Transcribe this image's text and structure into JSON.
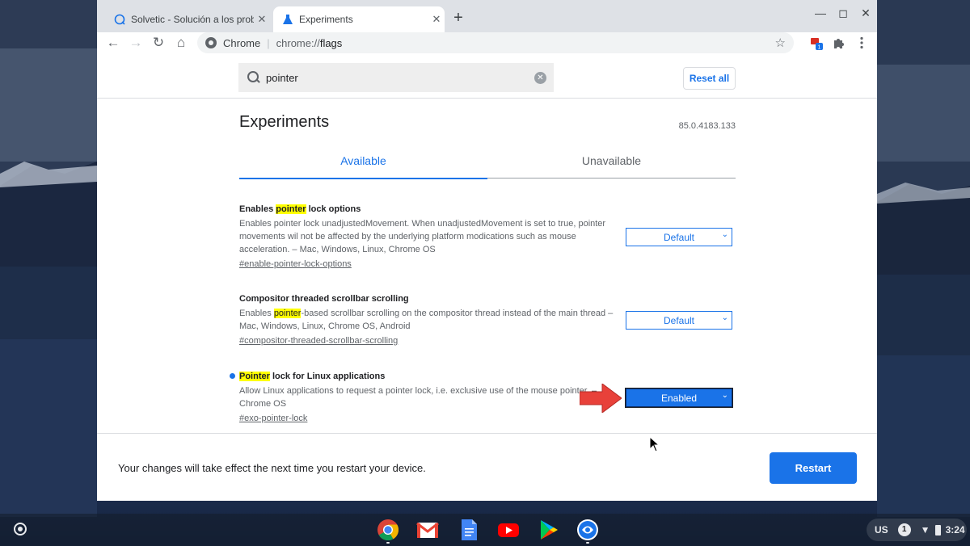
{
  "browser": {
    "tabs": [
      {
        "title": "Solvetic - Solución a los problem",
        "close": "✕"
      },
      {
        "title": "Experiments",
        "close": "✕"
      }
    ],
    "new_tab": "+",
    "window_controls": {
      "minimize": "—",
      "maximize": "◻",
      "close": "✕"
    }
  },
  "toolbar": {
    "back": "←",
    "forward": "→",
    "reload": "↻",
    "home": "⌂",
    "omnibox": {
      "site_label": "Chrome",
      "separator": "|",
      "scheme": "chrome://",
      "host": "flags"
    },
    "star": "☆",
    "extension_badge": "1"
  },
  "flags": {
    "search": {
      "value": "pointer"
    },
    "reset_all": "Reset all",
    "title": "Experiments",
    "version": "85.0.4183.133",
    "tabs": {
      "available": "Available",
      "unavailable": "Unavailable"
    },
    "experiments": [
      {
        "name_pre": "Enables ",
        "name_hl": "pointer",
        "name_post": " lock options",
        "desc_pre": "",
        "desc_hl": "",
        "desc_post": "Enables pointer lock unadjustedMovement. When unadjustedMovement is set to true, pointer movements wil not be affected by the underlying platform modications such as mouse acceleration. – Mac, Windows, Linux, Chrome OS",
        "link": "#enable-pointer-lock-options",
        "select": "Default"
      },
      {
        "name_pre": "Compositor threaded scrollbar scrolling",
        "name_hl": "",
        "name_post": "",
        "desc_pre": "Enables ",
        "desc_hl": "pointer",
        "desc_post": "-based scrollbar scrolling on the compositor thread instead of the main thread – Mac, Windows, Linux, Chrome OS, Android",
        "link": "#compositor-threaded-scrollbar-scrolling",
        "select": "Default"
      },
      {
        "name_pre": "",
        "name_hl": "Pointer",
        "name_post": " lock for Linux applications",
        "desc_pre": "",
        "desc_hl": "",
        "desc_post": "Allow Linux applications to request a pointer lock, i.e. exclusive use of the mouse pointer. – Chrome OS",
        "link": "#exo-pointer-lock",
        "select": "Enabled"
      }
    ],
    "restart_notice": "Your changes will take effect the next time you restart your device.",
    "restart": "Restart"
  },
  "shelf": {
    "apps": [
      "chrome-icon",
      "gmail-icon",
      "docs-icon",
      "youtube-icon",
      "play-store-icon",
      "solvetic-icon"
    ],
    "status": {
      "locale": "US",
      "notifications": "1",
      "time": "3:24"
    }
  },
  "colors": {
    "accent": "#1a73e8",
    "highlight": "#ffff00",
    "annotation_arrow": "#e8413a"
  }
}
